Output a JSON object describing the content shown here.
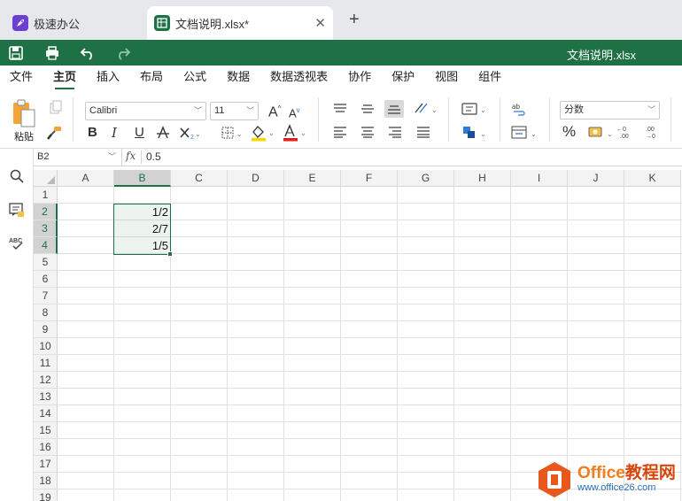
{
  "tabs": [
    {
      "label": "极速办公",
      "icon": "rocket-icon"
    },
    {
      "label": "文档说明.xlsx*",
      "icon": "spreadsheet-icon",
      "close": "✕"
    }
  ],
  "new_tab": "+",
  "title": "文档说明.xlsx",
  "menu": [
    "文件",
    "主页",
    "插入",
    "布局",
    "公式",
    "数据",
    "数据透视表",
    "协作",
    "保护",
    "视图",
    "组件"
  ],
  "ribbon": {
    "paste_label": "粘贴",
    "font_name": "Calibri",
    "font_size": "11",
    "number_format": "分数",
    "bold": "B",
    "italic": "I",
    "underline": "U",
    "percent": "%",
    "increase_font": "A",
    "decrease_font": "A"
  },
  "formula_bar": {
    "cell_ref": "B2",
    "fx": "fx",
    "value": "0.5"
  },
  "columns": [
    "A",
    "B",
    "C",
    "D",
    "E",
    "F",
    "G",
    "H",
    "I",
    "J",
    "K"
  ],
  "rows": [
    "1",
    "2",
    "3",
    "4",
    "5",
    "6",
    "7",
    "8",
    "9",
    "10",
    "11",
    "12",
    "13",
    "14",
    "15",
    "16",
    "17",
    "18",
    "19"
  ],
  "cells": {
    "B2": "1/2",
    "B3": "2/7",
    "B4": "1/5"
  },
  "watermark": {
    "brand": "Office",
    "brand2": "教程网",
    "url": "www.office26.com"
  },
  "colors": {
    "accent": "#1e7145",
    "tab_bg": "#e6e8eb",
    "watermark_orange": "#f07e1b"
  }
}
